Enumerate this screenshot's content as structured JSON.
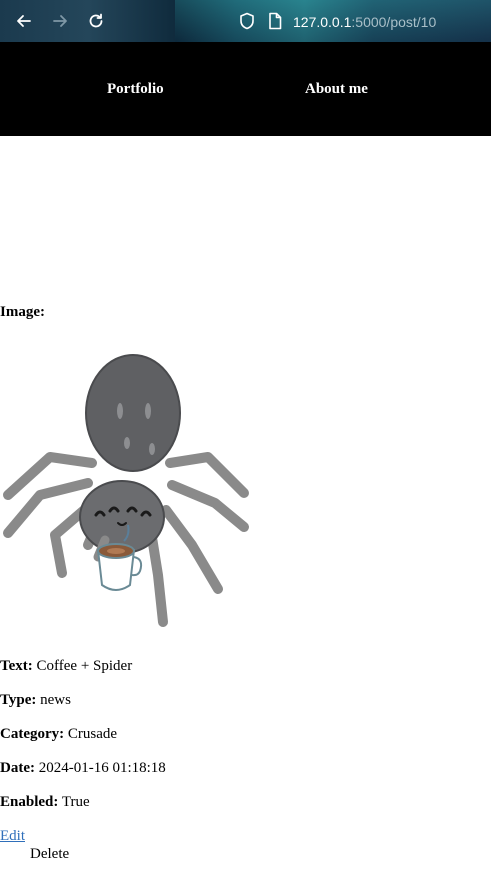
{
  "browser": {
    "url_host": "127.0.0.1",
    "url_rest": ":5000/post/10"
  },
  "nav": {
    "items": [
      {
        "label": "Portfolio"
      },
      {
        "label": "About me"
      }
    ]
  },
  "post": {
    "image_label": "Image:",
    "image_alt": "coffee-spider-illustration",
    "fields": [
      {
        "label": "Text:",
        "value": "Coffee + Spider"
      },
      {
        "label": "Type:",
        "value": "news"
      },
      {
        "label": "Category:",
        "value": "Crusade"
      },
      {
        "label": "Date:",
        "value": "2024-01-16 01:18:18"
      },
      {
        "label": "Enabled:",
        "value": "True"
      }
    ],
    "edit_label": "Edit",
    "delete_label": "Delete"
  },
  "colors": {
    "nav_bg": "#000000",
    "link": "#2f6fba"
  }
}
